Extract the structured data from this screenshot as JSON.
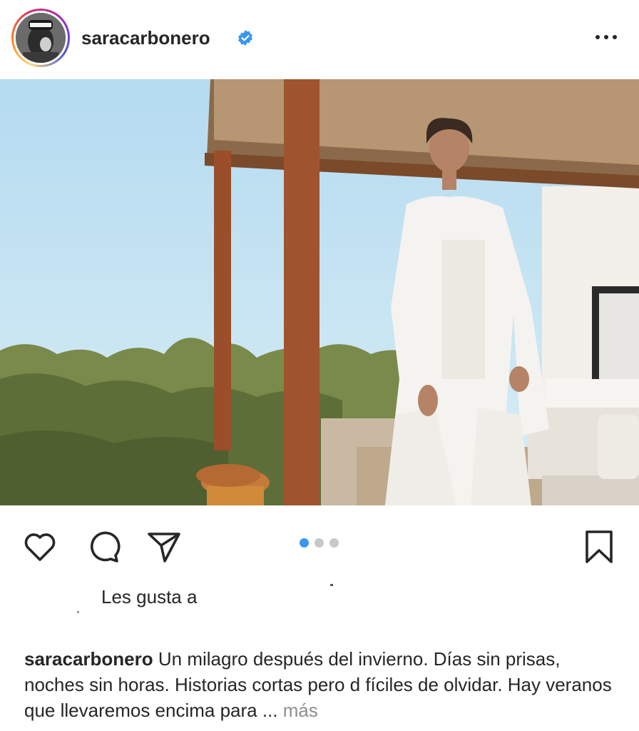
{
  "header": {
    "username": "saracarbonero",
    "verified_icon": "verified-badge-icon",
    "more_icon": "more-options-icon"
  },
  "post": {
    "image_description": "photo",
    "carousel": {
      "total": 3,
      "active_index": 0
    }
  },
  "actions": {
    "like_icon": "heart-icon",
    "comment_icon": "comment-icon",
    "share_icon": "paper-plane-icon",
    "save_icon": "bookmark-icon"
  },
  "likes": {
    "label": "Les gusta a"
  },
  "caption": {
    "username": "saracarbonero",
    "text": "Un milagro después del invierno. Días sin prisas, noches sin horas. Historias cortas pero d fíciles de olvidar. Hay veranos que llevaremos encima para",
    "ellipsis": "...",
    "more_label": "más"
  },
  "colors": {
    "accent_blue": "#3897f0",
    "verified_blue": "#3897f0",
    "text": "#262626",
    "muted": "#8e8e8e"
  }
}
